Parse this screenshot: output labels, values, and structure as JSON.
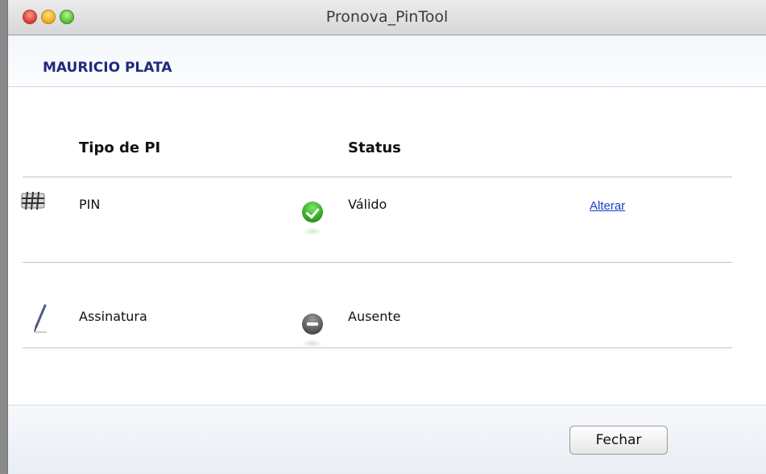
{
  "window": {
    "title": "Pronova_PinTool"
  },
  "header": {
    "user_name": "MAURICIO PLATA"
  },
  "table": {
    "columns": {
      "type": "Tipo de PI",
      "status": "Status"
    },
    "rows": [
      {
        "icon": "keypad-icon",
        "type": "PIN",
        "status_icon": "check-circle-icon",
        "status": "Válido",
        "action": "Alterar"
      },
      {
        "icon": "pen-icon",
        "type": "Assinatura",
        "status_icon": "minus-circle-icon",
        "status": "Ausente",
        "action": ""
      }
    ]
  },
  "footer": {
    "close_label": "Fechar"
  },
  "colors": {
    "user_name": "#1f2a7a",
    "link": "#1a3ec8",
    "ok": "#2ea51d",
    "absent": "#555555"
  }
}
